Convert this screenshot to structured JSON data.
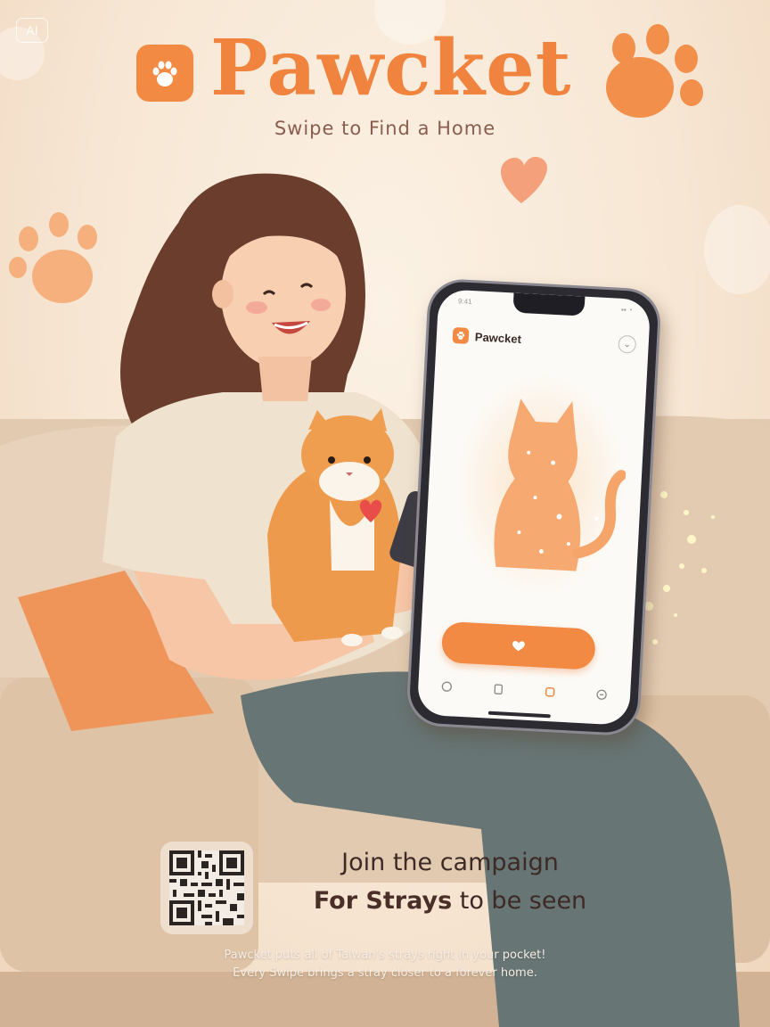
{
  "badge": "AI",
  "brand": {
    "name": "Pawcket",
    "tagline": "Swipe to Find a Home"
  },
  "phone_app": {
    "status_time": "9:41",
    "status_icons": "▪▪ ◔",
    "title": "Pawcket",
    "menu_icon": "chevron-down-icon",
    "like_icon": "heart-icon",
    "tabs": [
      "chat-icon",
      "document-icon",
      "card-icon",
      "profile-icon"
    ]
  },
  "campaign": {
    "line1": "Join the campaign",
    "line2_strong": "For Strays",
    "line2_rest": " to be seen"
  },
  "blurb": {
    "line1": "Pawcket puts all of Taiwan's strays right in your pocket!",
    "line2": "Every Swipe brings a stray closer to a forever home."
  },
  "colors": {
    "brand_orange": "#f0833d",
    "background": "#f8e9d8",
    "text_dark": "#3d2a26"
  }
}
